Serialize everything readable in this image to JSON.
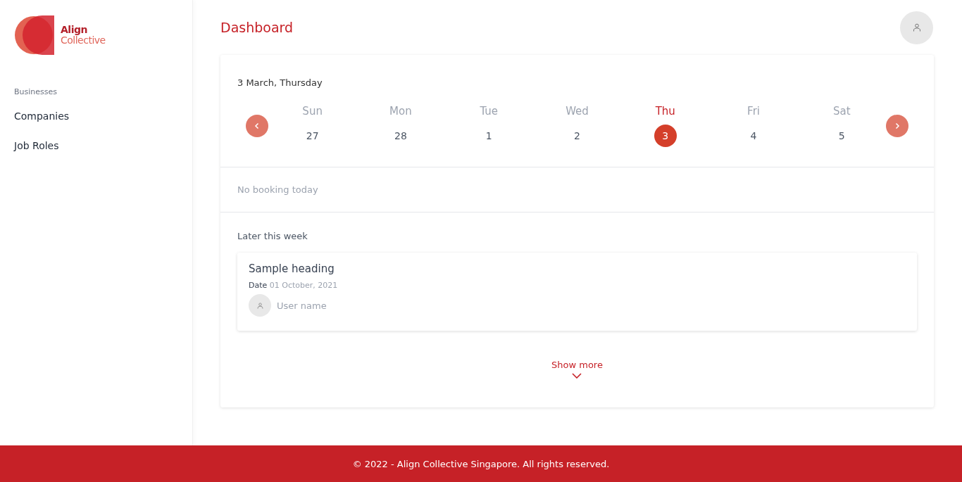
{
  "logo": {
    "line_1": "Align",
    "line_2": "Collective"
  },
  "sidebar": {
    "section": "Businesses",
    "items": [
      {
        "label": "Companies"
      },
      {
        "label": "Job Roles"
      }
    ]
  },
  "header": {
    "title": "Dashboard"
  },
  "calendar": {
    "date_label": "3 March, Thursday",
    "days": [
      {
        "weekday": "Sun",
        "day": "27",
        "selected": false
      },
      {
        "weekday": "Mon",
        "day": "28",
        "selected": false
      },
      {
        "weekday": "Tue",
        "day": "1",
        "selected": false
      },
      {
        "weekday": "Wed",
        "day": "2",
        "selected": false
      },
      {
        "weekday": "Thu",
        "day": "3",
        "selected": true
      },
      {
        "weekday": "Fri",
        "day": "4",
        "selected": false
      },
      {
        "weekday": "Sat",
        "day": "5",
        "selected": false
      }
    ]
  },
  "today": {
    "message": "No booking today"
  },
  "later": {
    "title": "Later this week",
    "bookings": [
      {
        "heading": "Sample heading",
        "date_label": "Date",
        "date": "01 October, 2021",
        "user": "User name"
      }
    ],
    "show_more": "Show more"
  },
  "footer": {
    "text": "© 2022 - Align Collective Singapore. All rights reserved."
  }
}
